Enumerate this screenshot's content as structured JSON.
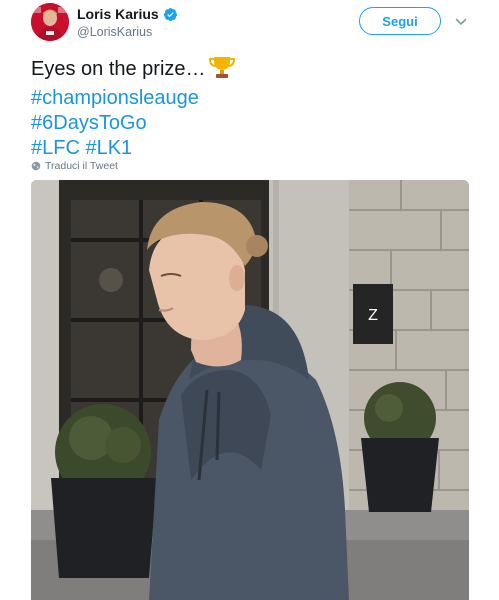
{
  "author": {
    "name": "Loris Karius",
    "handle": "@LorisKarius",
    "verified": true
  },
  "follow_button_label": "Segui",
  "tweet": {
    "text_lines": [
      "Eyes on the prize…",
      "#championsleauge",
      "#6DaysToGo",
      "#LFC",
      "#LK1"
    ],
    "translate_label": "Traduci il Tweet"
  },
  "photo": {
    "shop_sign_letter": "Z"
  },
  "colors": {
    "link": "#1b95e0",
    "follow_border": "#1da1f2",
    "secondary_text": "#657786",
    "primary_text": "#14171a"
  },
  "icons": {
    "verified": "verified-badge-icon",
    "caret": "chevron-down-icon",
    "trophy": "trophy-emoji-icon",
    "translate": "globe-icon"
  }
}
